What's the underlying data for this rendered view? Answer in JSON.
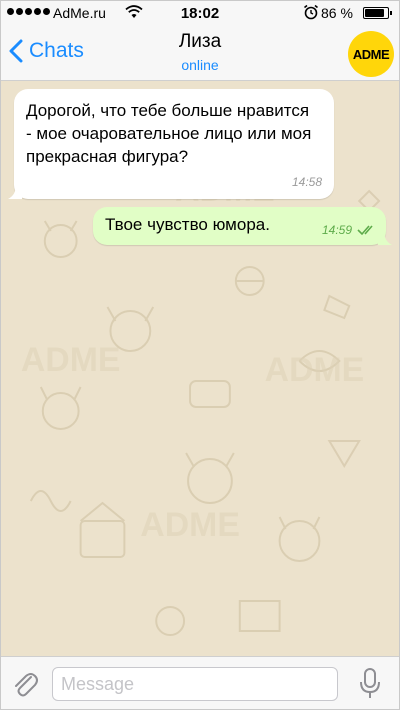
{
  "status_bar": {
    "carrier": "AdMe.ru",
    "time": "18:02",
    "battery_percent": "86 %",
    "battery_level": 0.86
  },
  "nav": {
    "back_label": "Chats",
    "contact_name": "Лиза",
    "contact_status": "online",
    "avatar_text": "ADME"
  },
  "messages": [
    {
      "direction": "incoming",
      "text": "Дорогой, что тебе больше нравится - мое очаровательное лицо или моя прекрасная фигура?",
      "time": "14:58"
    },
    {
      "direction": "outgoing",
      "text": "Твое чувство юмора.",
      "time": "14:59",
      "read": true
    }
  ],
  "input": {
    "placeholder": "Message"
  },
  "colors": {
    "accent": "#1a8cff",
    "chat_background": "#ece2cc",
    "outgoing_bubble": "#e1fec6",
    "avatar": "#ffd60a"
  }
}
